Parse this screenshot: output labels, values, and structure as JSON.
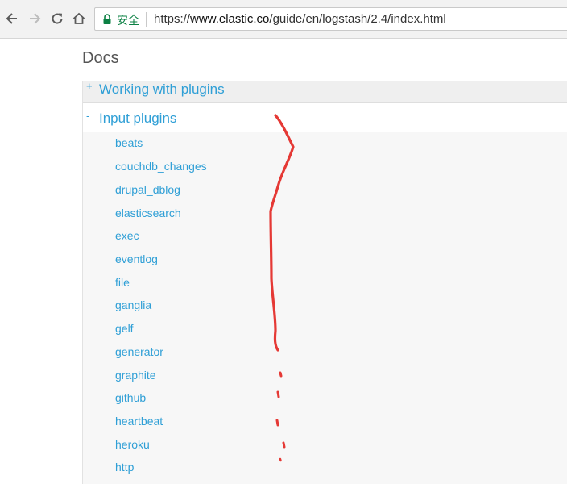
{
  "browser": {
    "back_icon": "arrow-left-icon",
    "forward_icon": "arrow-right-icon",
    "reload_icon": "reload-icon",
    "home_icon": "home-icon",
    "lock_icon": "lock-icon",
    "secure_label": "安全",
    "url_scheme": "https://",
    "url_host": "www.elastic.co",
    "url_path": "/guide/en/logstash/2.4/index.html",
    "secure_color": "#0b8043"
  },
  "header": {
    "title": "Docs"
  },
  "nav": {
    "working_with_plugins": {
      "toggle": "+",
      "label": "Working with plugins"
    },
    "input_plugins": {
      "toggle": "-",
      "label": "Input plugins"
    },
    "plugins": [
      "beats",
      "couchdb_changes",
      "drupal_dblog",
      "elasticsearch",
      "exec",
      "eventlog",
      "file",
      "ganglia",
      "gelf",
      "generator",
      "graphite",
      "github",
      "heartbeat",
      "heroku",
      "http"
    ],
    "link_color": "#2f9fd6"
  },
  "annotation": {
    "color": "#e53935"
  }
}
